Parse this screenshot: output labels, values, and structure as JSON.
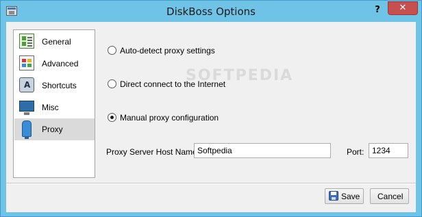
{
  "window": {
    "title": "DiskBoss Options",
    "help_glyph": "?",
    "close_glyph": "✕"
  },
  "sidebar": {
    "items": [
      {
        "label": "General",
        "icon": "general-icon",
        "selected": false
      },
      {
        "label": "Advanced",
        "icon": "advanced-icon",
        "selected": false
      },
      {
        "label": "Shortcuts",
        "icon": "shortcuts-icon",
        "selected": false
      },
      {
        "label": "Misc",
        "icon": "misc-icon",
        "selected": false
      },
      {
        "label": "Proxy",
        "icon": "proxy-icon",
        "selected": true
      }
    ]
  },
  "proxy": {
    "options": [
      {
        "label": "Auto-detect proxy settings",
        "checked": false
      },
      {
        "label": "Direct connect to the Internet",
        "checked": false
      },
      {
        "label": "Manual proxy configuration",
        "checked": true
      }
    ],
    "host_label": "Proxy Server Host Name:",
    "host_value": "Softpedia",
    "port_label": "Port:",
    "port_value": "1234"
  },
  "watermark": "SOFTPEDIA",
  "buttons": {
    "save_label": "Save",
    "cancel_label": "Cancel"
  },
  "colors": {
    "title_bar": "#6ec3e6",
    "close_button": "#c74f4f",
    "selected_item": "#dadada"
  }
}
